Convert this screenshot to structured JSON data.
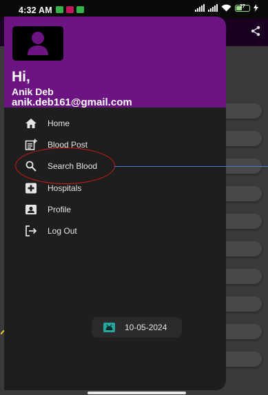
{
  "status_bar": {
    "time": "4:32 AM",
    "battery": "27"
  },
  "drawer": {
    "greeting": "Hi,",
    "user_name": "Anik Deb",
    "user_email": "anik.deb161@gmail.com",
    "header_color": "#6d1483",
    "items": [
      {
        "label": "Home",
        "icon": "home-icon"
      },
      {
        "label": "Blood Post",
        "icon": "post-add-icon"
      },
      {
        "label": "Search Blood",
        "icon": "search-icon"
      },
      {
        "label": "Hospitals",
        "icon": "hospital-icon"
      },
      {
        "label": "Profile",
        "icon": "profile-icon"
      },
      {
        "label": "Log Out",
        "icon": "logout-icon"
      }
    ],
    "date": "10-05-2024"
  }
}
